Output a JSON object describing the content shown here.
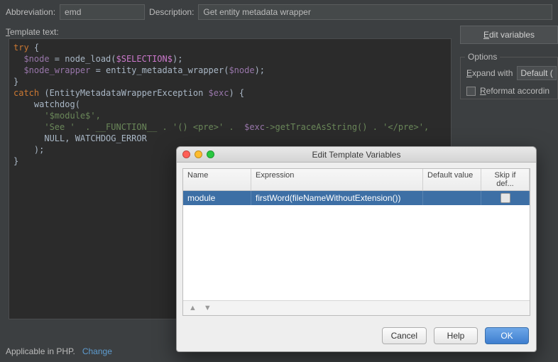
{
  "labels": {
    "abbreviation": "Abbreviation:",
    "description": "Description:",
    "template_text": "Template text:"
  },
  "fields": {
    "abbreviation": "emd",
    "description": "Get entity metadata wrapper"
  },
  "template_code": {
    "l1a": "try",
    "l1b": " {",
    "l2a": "  $node",
    "l2b": " = node_load(",
    "l2c": "$SELECTION$",
    "l2d": ");",
    "l3a": "  $node_wrapper",
    "l3b": " = entity_metadata_wrapper(",
    "l3c": "$node",
    "l3d": ");",
    "l4": "}",
    "l5a": "catch",
    "l5b": " (EntityMetadataWrapperException ",
    "l5c": "$exc",
    "l5d": ") {",
    "l6": "    watchdog(",
    "l7": "      '$module$',",
    "l8a": "      'See '  . __FUNCTION__ . '() <pre>' .  ",
    "l8b": "$exc",
    "l8c": "->getTraceAsString() . '</pre>',",
    "l9": "      NULL, WATCHDOG_ERROR",
    "l10": "    );",
    "l11": "}"
  },
  "right": {
    "edit_variables": "Edit variables",
    "options_title": "Options",
    "expand_with": "Expand with",
    "expand_value": "Default (",
    "reformat": "Reformat accordin"
  },
  "footer": {
    "applicable": "Applicable in PHP.",
    "change": "Change"
  },
  "dialog": {
    "title": "Edit Template Variables",
    "columns": {
      "name": "Name",
      "expression": "Expression",
      "default": "Default value",
      "skip": "Skip if def..."
    },
    "rows": [
      {
        "name": "module",
        "expression": "firstWord(fileNameWithoutExtension())",
        "default": "",
        "skip": false
      }
    ],
    "buttons": {
      "cancel": "Cancel",
      "help": "Help",
      "ok": "OK"
    }
  }
}
